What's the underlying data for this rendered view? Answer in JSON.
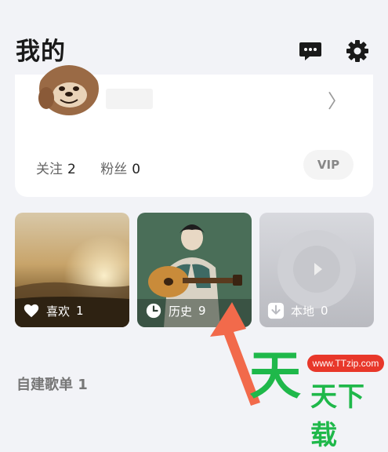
{
  "header": {
    "title": "我的",
    "icons": [
      "message-icon",
      "gear-icon"
    ]
  },
  "profile": {
    "chevron": "〉",
    "following_label": "关注",
    "following_count": "2",
    "fans_label": "粉丝",
    "fans_count": "0",
    "vip_label": "VIP"
  },
  "tiles": [
    {
      "label": "喜欢",
      "count": "1",
      "icon": "heart-icon"
    },
    {
      "label": "历史",
      "count": "9",
      "icon": "clock-icon"
    },
    {
      "label": "本地",
      "count": "0",
      "icon": "download-icon"
    }
  ],
  "section": {
    "title": "自建歌单 1"
  },
  "watermark": {
    "url": "www.TTzip.com",
    "big_char": "天",
    "text": "天下载"
  },
  "colors": {
    "background": "#f2f3f7",
    "card": "#ffffff",
    "arrow": "#f26a4b",
    "watermark_green": "#1fb84a",
    "watermark_red": "#e8372a"
  }
}
